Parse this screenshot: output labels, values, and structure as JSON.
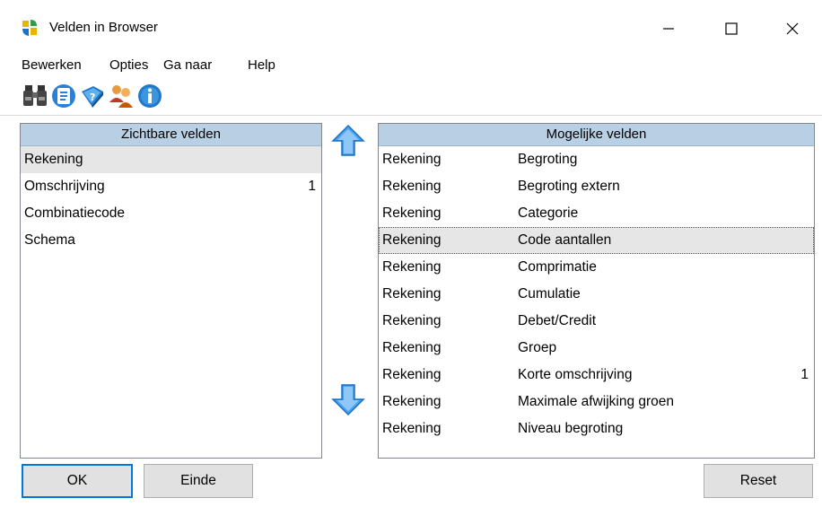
{
  "window": {
    "title": "Velden in Browser"
  },
  "menu": [
    "Bewerken",
    "Opties",
    "Ga naar",
    "Help"
  ],
  "toolbar": {
    "icons": [
      "binoculars-icon",
      "list-icon",
      "help-book-icon",
      "users-icon",
      "info-icon"
    ]
  },
  "visible_fields": {
    "header": "Zichtbare velden",
    "rows": [
      {
        "name": "Rekening",
        "num": ""
      },
      {
        "name": "Omschrijving",
        "num": "1"
      },
      {
        "name": "Combinatiecode",
        "num": ""
      },
      {
        "name": "Schema",
        "num": ""
      }
    ]
  },
  "possible_fields": {
    "header": "Mogelijke velden",
    "rows": [
      {
        "group": "Rekening",
        "name": "Begroting",
        "num": ""
      },
      {
        "group": "Rekening",
        "name": "Begroting extern",
        "num": ""
      },
      {
        "group": "Rekening",
        "name": "Categorie",
        "num": ""
      },
      {
        "group": "Rekening",
        "name": "Code aantallen",
        "num": ""
      },
      {
        "group": "Rekening",
        "name": "Comprimatie",
        "num": ""
      },
      {
        "group": "Rekening",
        "name": "Cumulatie",
        "num": ""
      },
      {
        "group": "Rekening",
        "name": "Debet/Credit",
        "num": ""
      },
      {
        "group": "Rekening",
        "name": "Groep",
        "num": ""
      },
      {
        "group": "Rekening",
        "name": "Korte omschrijving",
        "num": "1"
      },
      {
        "group": "Rekening",
        "name": "Maximale afwijking groen",
        "num": ""
      },
      {
        "group": "Rekening",
        "name": "Niveau begroting",
        "num": ""
      }
    ]
  },
  "buttons": {
    "ok": "OK",
    "einde": "Einde",
    "reset": "Reset"
  },
  "colors": {
    "header_bg": "#b9cfe3",
    "accent": "#0078d7",
    "arrow": "#3a8fe0"
  }
}
